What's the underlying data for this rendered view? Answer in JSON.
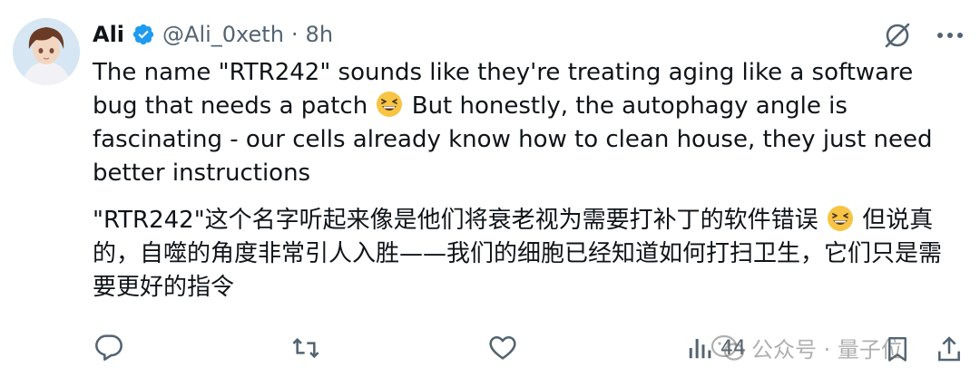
{
  "tweet": {
    "author_name": "Ali",
    "handle": "@Ali_0xeth",
    "separator": "·",
    "time": "8h",
    "verified": true,
    "icons": {
      "avatar": "avatar-image",
      "verified": "verified-badge-icon",
      "grok": "grok-icon",
      "more": "more-icon"
    },
    "text_en": [
      "The name \"RTR242\" sounds like they're treating aging like a software bug that needs a patch ",
      " But honestly, the autophagy angle is fascinating - our cells already know how to clean house, they just need better instructions"
    ],
    "text_zh": [
      "\"RTR242\"这个名字听起来像是他们将衰老视为需要打补丁的软件错误 ",
      " 但说真的，自噬的角度非常引人入胜——我们的细胞已经知道如何打扫卫生，它们只是需要更好的指令"
    ],
    "emoji": "grinning-squinting-face"
  },
  "actions": {
    "reply_icon": "reply-icon",
    "retweet_icon": "retweet-icon",
    "like_icon": "heart-icon",
    "views_icon": "views-icon",
    "views_count": "44",
    "bookmark_icon": "bookmark-icon",
    "share_icon": "share-icon"
  },
  "watermark": {
    "label": "公众号 · 量子位"
  },
  "colors": {
    "text": "#0f1419",
    "muted": "#536471",
    "verified": "#1d9bf0",
    "emoji": "#f7c443"
  }
}
